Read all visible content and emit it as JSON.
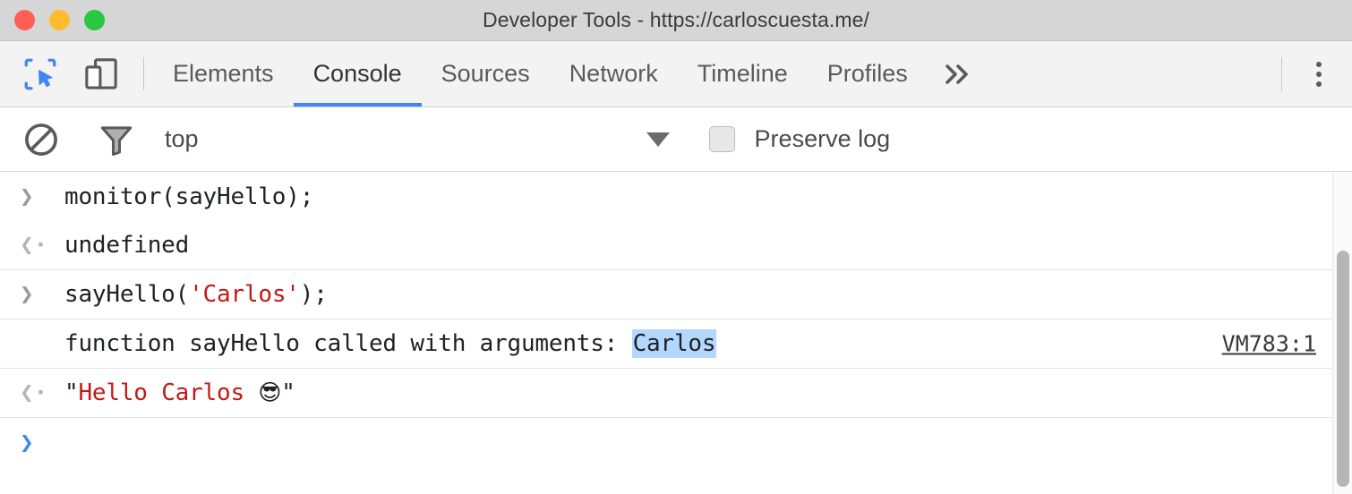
{
  "window": {
    "title": "Developer Tools - https://carloscuesta.me/",
    "traffic_lights": [
      {
        "name": "close",
        "color": "#ff5f56"
      },
      {
        "name": "minimize",
        "color": "#febc2e"
      },
      {
        "name": "zoom",
        "color": "#28c840"
      }
    ]
  },
  "toolbar": {
    "inspect_icon": "inspect-element-icon",
    "device_icon": "device-toolbar-icon",
    "accent_color": "#4285f4",
    "tabs": [
      {
        "label": "Elements",
        "active": false
      },
      {
        "label": "Console",
        "active": true
      },
      {
        "label": "Sources",
        "active": false
      },
      {
        "label": "Network",
        "active": false
      },
      {
        "label": "Timeline",
        "active": false
      },
      {
        "label": "Profiles",
        "active": false
      }
    ],
    "overflow_label": "»",
    "menu_icon": "kebab-menu-icon"
  },
  "filter_bar": {
    "clear_icon": "clear-console-icon",
    "filter_icon": "filter-funnel-icon",
    "context": "top",
    "context_caret": "chevron-down-icon",
    "preserve_log_label": "Preserve log",
    "preserve_log_checked": false
  },
  "console": {
    "rows": [
      {
        "type": "input",
        "marker": "input-arrow",
        "text": "monitor(sayHello);",
        "separator_below": false
      },
      {
        "type": "output",
        "marker": "output-arrow",
        "text": "undefined",
        "separator_below": true
      },
      {
        "type": "input",
        "marker": "input-arrow",
        "text": "sayHello('Carlos');",
        "code_prefix": "sayHello(",
        "code_string": "'Carlos'",
        "code_suffix": ");",
        "separator_below": true
      },
      {
        "type": "message",
        "marker": "",
        "text": "function sayHello called with arguments: Carlos",
        "message_prefix": "function sayHello called with arguments: ",
        "highlighted": "Carlos",
        "source_link": "VM783:1",
        "separator_below": true
      },
      {
        "type": "output",
        "marker": "output-arrow",
        "text": "\"Hello Carlos 😎\"",
        "result_open_quote": "\"",
        "result_value": "Hello Carlos ",
        "result_emoji": "😎",
        "result_close_quote": "\"",
        "separator_below": true
      },
      {
        "type": "prompt",
        "marker": "prompt-arrow",
        "text": "",
        "separator_below": false
      }
    ],
    "scrollbar": {
      "name": "vertical-scrollbar"
    }
  }
}
